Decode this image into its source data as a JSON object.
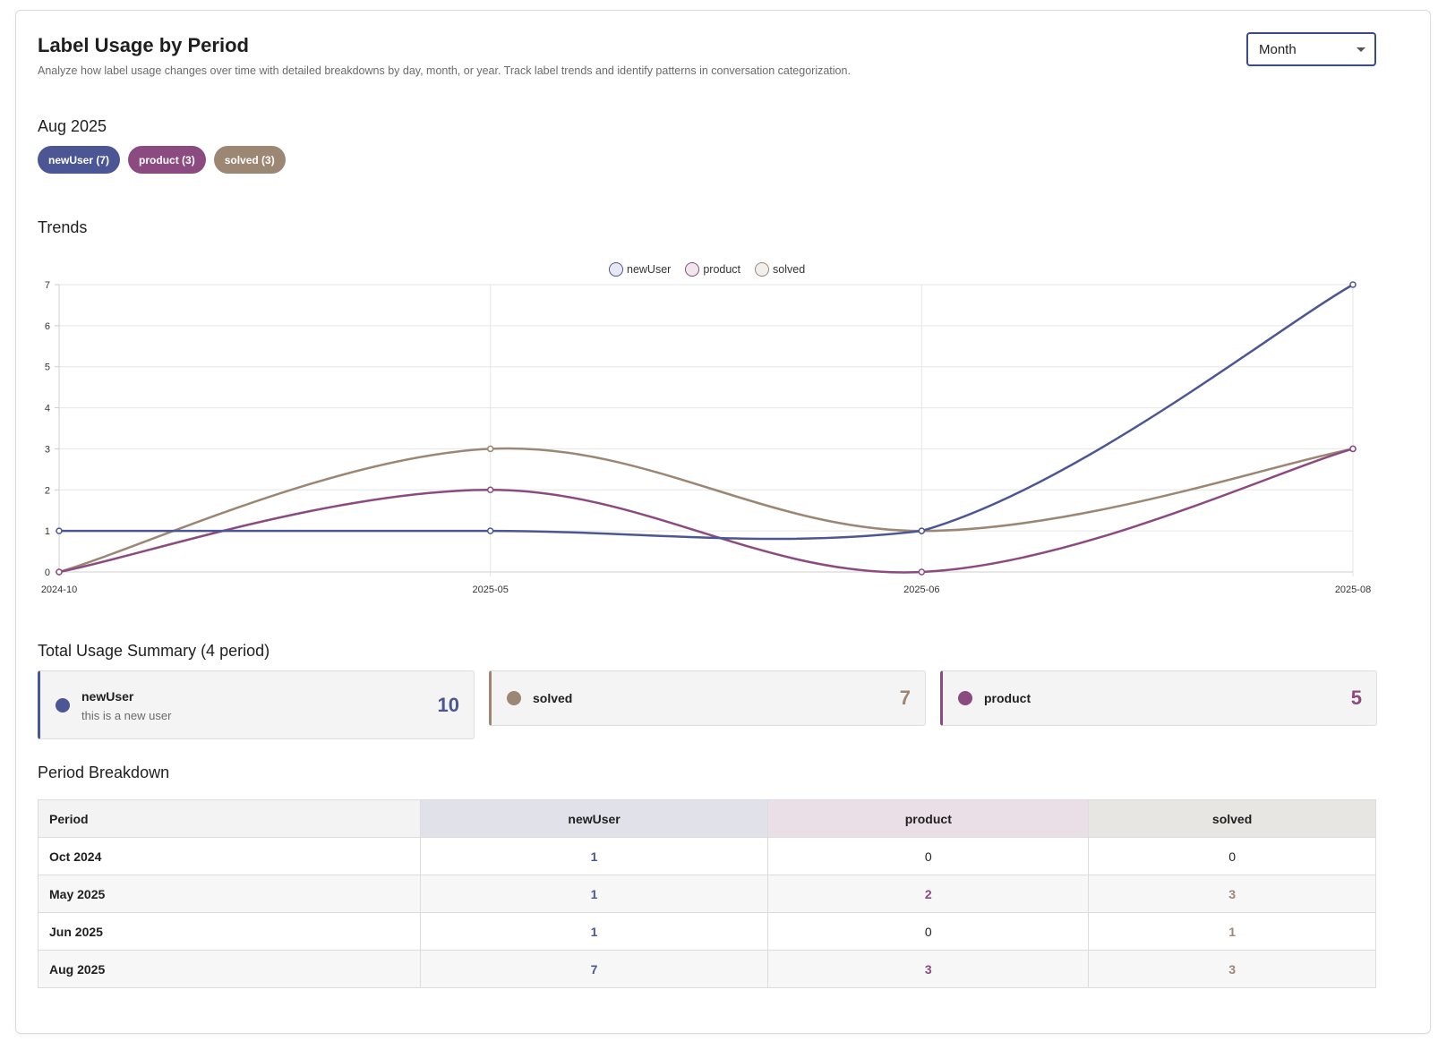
{
  "header": {
    "title": "Label Usage by Period",
    "subtitle": "Analyze how label usage changes over time with detailed breakdowns by day, month, or year. Track label trends and identify patterns in conversation categorization."
  },
  "period_select": {
    "value": "Month"
  },
  "current_period": {
    "title": "Aug 2025",
    "chips": [
      {
        "label": "newUser (7)",
        "color": "#4d5694"
      },
      {
        "label": "product (3)",
        "color": "#8b4a80"
      },
      {
        "label": "solved (3)",
        "color": "#9c8674"
      }
    ]
  },
  "trends": {
    "title": "Trends"
  },
  "chart_data": {
    "type": "line",
    "x": [
      "2024-10",
      "2025-05",
      "2025-06",
      "2025-08"
    ],
    "ylim": [
      0,
      7
    ],
    "yticks": [
      "0",
      "1",
      "2",
      "3",
      "4",
      "5",
      "6",
      "7"
    ],
    "grid": true,
    "legend_position": "top-center",
    "series": [
      {
        "name": "newUser",
        "values": [
          1,
          1,
          1,
          7
        ],
        "color": "#4d5694"
      },
      {
        "name": "product",
        "values": [
          0,
          2,
          0,
          3
        ],
        "color": "#8b4a80"
      },
      {
        "name": "solved",
        "values": [
          0,
          3,
          1,
          3
        ],
        "color": "#9c8674"
      }
    ]
  },
  "summary": {
    "title": "Total Usage Summary (4 period)",
    "items": [
      {
        "name": "newUser",
        "description": "this is a new user",
        "count": "10",
        "color": "#4d5694"
      },
      {
        "name": "solved",
        "description": "",
        "count": "7",
        "color": "#9c8674"
      },
      {
        "name": "product",
        "description": "",
        "count": "5",
        "color": "#8b4a80"
      }
    ]
  },
  "breakdown": {
    "title": "Period Breakdown",
    "columns": [
      "Period",
      "newUser",
      "product",
      "solved"
    ],
    "header_colors": [
      "#f3f3f3",
      "#e1e1ea",
      "#ebdfe7",
      "#e8e6e3"
    ],
    "rows": [
      {
        "period": "Oct 2024",
        "values": [
          "1",
          "0",
          "0"
        ]
      },
      {
        "period": "May 2025",
        "values": [
          "1",
          "2",
          "3"
        ]
      },
      {
        "period": "Jun 2025",
        "values": [
          "1",
          "0",
          "1"
        ]
      },
      {
        "period": "Aug 2025",
        "values": [
          "7",
          "3",
          "3"
        ]
      }
    ]
  }
}
